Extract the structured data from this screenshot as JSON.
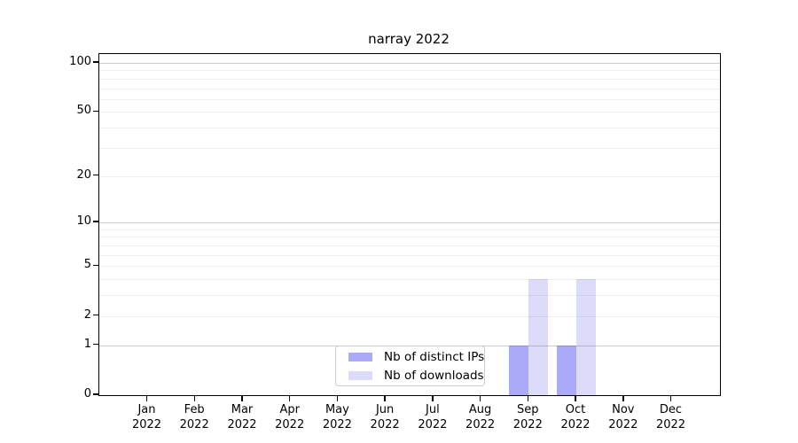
{
  "chart_data": {
    "type": "bar",
    "title": "narray 2022",
    "categories": [
      "Jan",
      "Feb",
      "Mar",
      "Apr",
      "May",
      "Jun",
      "Jul",
      "Aug",
      "Sep",
      "Oct",
      "Nov",
      "Dec"
    ],
    "category_year": "2022",
    "series": [
      {
        "name": "Nb of distinct IPs",
        "color": "#aaaaf8",
        "values": [
          0,
          0,
          0,
          0,
          0,
          0,
          0,
          0,
          1,
          1,
          0,
          0
        ]
      },
      {
        "name": "Nb of downloads",
        "color": "#dcdcfa",
        "values": [
          0,
          0,
          0,
          0,
          0,
          0,
          0,
          0,
          4,
          4,
          0,
          0
        ]
      }
    ],
    "xlabel": "",
    "ylabel": "",
    "yscale": "log1p",
    "ylim": [
      0,
      113
    ],
    "y_ticks": [
      100,
      50,
      20,
      10,
      5,
      2,
      1,
      0
    ],
    "grid": "horizontal",
    "grid_major_values": [
      1,
      10,
      100
    ],
    "grid_minor_values": [
      2,
      3,
      4,
      5,
      6,
      7,
      8,
      9,
      20,
      30,
      40,
      50,
      60,
      70,
      80,
      90
    ],
    "legend": {
      "position": "bottom-center-inside",
      "entries": [
        "Nb of distinct IPs",
        "Nb of downloads"
      ]
    },
    "colors": {
      "bar_distinct_ips": "#aaaaf8",
      "bar_downloads": "#dcdcfa",
      "grid_major": "#cbcbcb",
      "grid_minor": "#ececec",
      "axis": "#000000"
    }
  }
}
